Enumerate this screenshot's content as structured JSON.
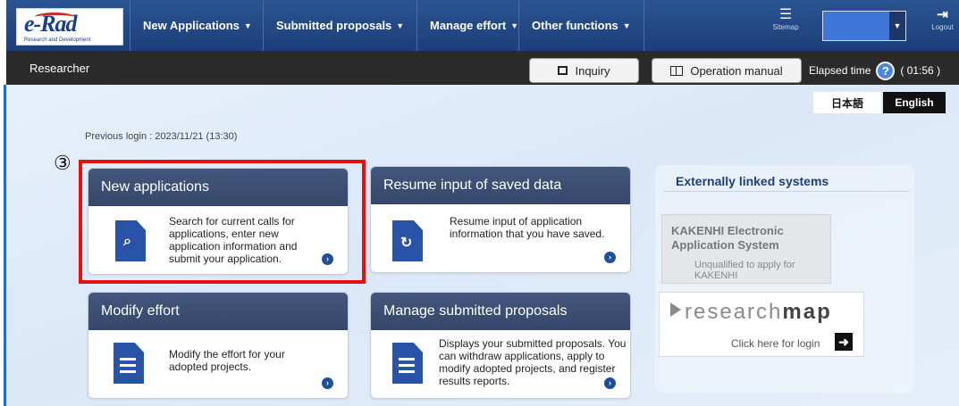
{
  "header": {
    "logo_text": "e-Rad",
    "logo_subtitle": "Research and Development",
    "menu": [
      {
        "label": "New Applications"
      },
      {
        "label": "Submitted proposals"
      },
      {
        "label": "Manage effort"
      },
      {
        "label": "Other functions"
      }
    ],
    "sitemap_label": "Sitemap",
    "logout_label": "Logout",
    "user_select_value": ""
  },
  "subbar": {
    "role": "Researcher",
    "inquiry_label": "Inquiry",
    "manual_label": "Operation manual",
    "elapsed_label": "Elapsed time",
    "elapsed_value": "( 01:56 )"
  },
  "language": {
    "japanese": "日本語",
    "english": "English",
    "selected": "English"
  },
  "main": {
    "previous_login": "Previous login : 2023/11/21 (13:30)",
    "step_marker": "③",
    "cards": [
      {
        "title": "New applications",
        "description": "Search for current calls for applications, enter new application information and submit your application.",
        "icon": "magnifier-document-icon"
      },
      {
        "title": "Resume input of saved data",
        "description": "Resume input of application information that you have saved.",
        "icon": "resume-document-icon"
      },
      {
        "title": "Modify effort",
        "description": "Modify the effort for your adopted projects.",
        "icon": "edit-document-icon"
      },
      {
        "title": "Manage submitted proposals",
        "description": "Displays your submitted proposals. You can withdraw applications, apply to modify adopted projects, and register results reports.",
        "icon": "list-document-icon"
      }
    ]
  },
  "external": {
    "heading": "Externally linked systems",
    "kakenhi_title_1": "KAKENHI Electronic",
    "kakenhi_title_2": "Application System",
    "kakenhi_note_1": "Unqualified to apply for",
    "kakenhi_note_2": "KAKENHI",
    "researchmap_prefix": "research",
    "researchmap_bold": "map",
    "researchmap_login": "Click here for login"
  },
  "colors": {
    "nav_blue": "#2b5492",
    "subbar_dark": "#2b2b2b",
    "card_header": "#3d4f73",
    "highlight_red": "#e01212"
  }
}
